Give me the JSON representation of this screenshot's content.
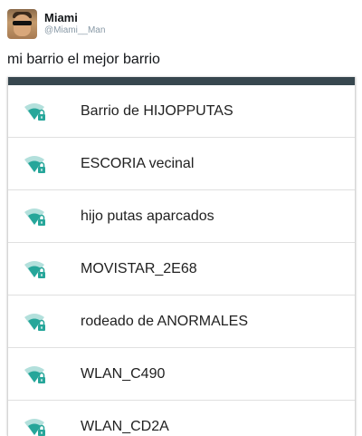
{
  "tweet": {
    "display_name": "Miami",
    "handle": "@Miami__Man",
    "text": "mi barrio el mejor barrio"
  },
  "colors": {
    "wifi_icon": "#26a69a",
    "header_bar": "#37474f",
    "divider": "#e0e0e0"
  },
  "networks": [
    {
      "name": "Barrio de HIJOPPUTAS",
      "icon": "wifi-locked-icon"
    },
    {
      "name": "ESCORIA vecinal",
      "icon": "wifi-locked-icon"
    },
    {
      "name": "hijo putas aparcados",
      "icon": "wifi-locked-icon"
    },
    {
      "name": "MOVISTAR_2E68",
      "icon": "wifi-locked-icon"
    },
    {
      "name": "rodeado de ANORMALES",
      "icon": "wifi-locked-icon"
    },
    {
      "name": "WLAN_C490",
      "icon": "wifi-locked-icon"
    },
    {
      "name": "WLAN_CD2A",
      "icon": "wifi-locked-icon"
    }
  ]
}
